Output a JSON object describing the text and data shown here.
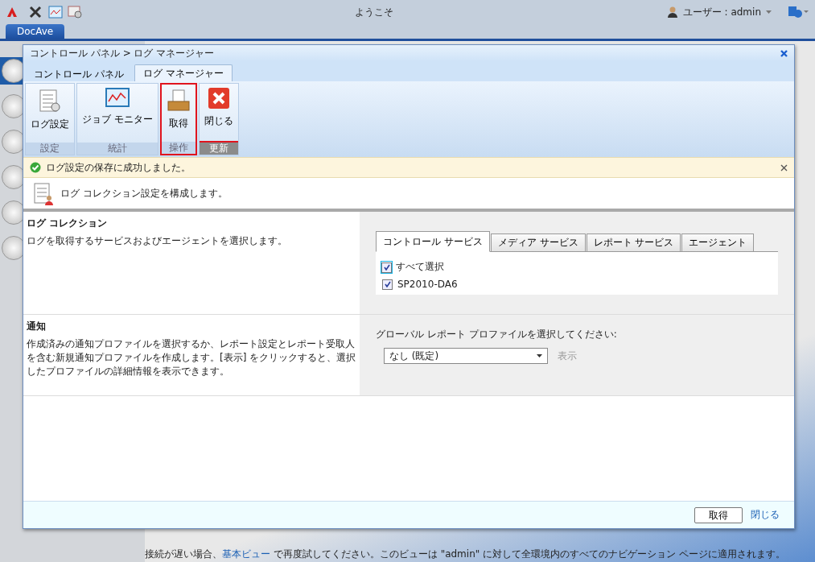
{
  "top_bar": {
    "title": "ようこそ",
    "user": "ユーザー : admin"
  },
  "app_tabs": [
    {
      "label": "DocAve",
      "selected": true
    }
  ],
  "sidebar": {
    "items": [
      {
        "selected": true
      },
      {
        "selected": false
      },
      {
        "selected": false
      },
      {
        "selected": false
      },
      {
        "selected": false
      },
      {
        "selected": false
      }
    ]
  },
  "dialog": {
    "title": "コントロール パネル > ログ マネージャー",
    "ribbon_tabs": [
      {
        "label": "コントロール パネル",
        "selected": false
      },
      {
        "label": "ログ マネージャー",
        "selected": true
      }
    ],
    "ribbon_groups": [
      {
        "label": "設定",
        "highlighted": false,
        "active": false,
        "buttons": [
          {
            "kind": "settings",
            "label": "ログ設定"
          }
        ]
      },
      {
        "label": "統計",
        "highlighted": false,
        "active": false,
        "buttons": [
          {
            "kind": "monitor",
            "label": "ジョブ モニター"
          }
        ]
      },
      {
        "label": "操作",
        "highlighted": true,
        "active": false,
        "buttons": [
          {
            "kind": "retrieve",
            "label": "取得"
          }
        ]
      },
      {
        "label": "更新",
        "highlighted": false,
        "active": true,
        "buttons": [
          {
            "kind": "close",
            "label": "閉じる"
          }
        ]
      }
    ],
    "message": "ログ設定の保存に成功しました。",
    "header": "ログ コレクション設定を構成します。",
    "sections": [
      {
        "kind": "tabs",
        "title": "ログ コレクション",
        "description": "ログを取得するサービスおよびエージェントを選択します。",
        "tabs": [
          {
            "label": "コントロール サービス",
            "selected": true
          },
          {
            "label": "メディア サービス",
            "selected": false
          },
          {
            "label": "レポート サービス",
            "selected": false
          },
          {
            "label": "エージェント",
            "selected": false
          }
        ],
        "checkboxes": [
          {
            "label": "すべて選択",
            "checked": true,
            "focused": true
          },
          {
            "label": "SP2010-DA6",
            "checked": true,
            "focused": false
          }
        ]
      },
      {
        "kind": "select",
        "title": "通知",
        "description": "作成済みの通知プロファイルを選択するか、レポート設定とレポート受取人を含む新規通知プロファイルを作成します。[表示] をクリックすると、選択したプロファイルの詳細情報を表示できます。",
        "field_label": "グローバル レポート プロファイルを選択してください:",
        "value": "なし (既定)",
        "link": {
          "label": "表示",
          "disabled": true
        }
      }
    ],
    "footer": {
      "button": "取得",
      "link": "閉じる"
    }
  },
  "bottom_note": {
    "before": "接続が遅い場合、",
    "link": "基本ビュー",
    "after": " で再度試してください。このビューは \"admin\" に対して全環境内のすべてのナビゲーション ページに適用されます。"
  }
}
